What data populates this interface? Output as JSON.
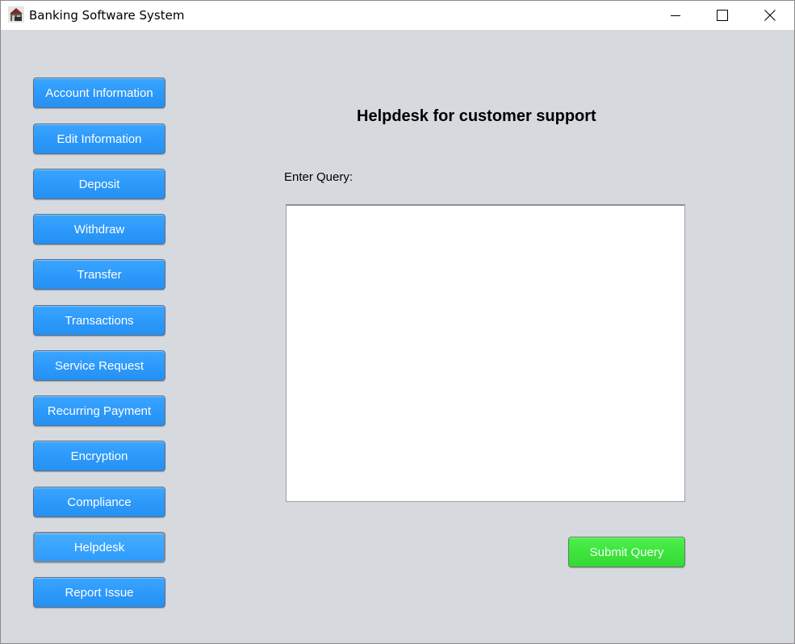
{
  "window": {
    "title": "Banking Software System",
    "icon": "bank-app-icon",
    "controls": {
      "minimize": "minimize-icon",
      "maximize": "maximize-icon",
      "close": "close-icon"
    }
  },
  "sidebar": {
    "items": [
      {
        "label": "Account Information",
        "name": "account-information-button"
      },
      {
        "label": "Edit Information",
        "name": "edit-information-button"
      },
      {
        "label": "Deposit",
        "name": "deposit-button"
      },
      {
        "label": "Withdraw",
        "name": "withdraw-button"
      },
      {
        "label": "Transfer",
        "name": "transfer-button"
      },
      {
        "label": "Transactions",
        "name": "transactions-button"
      },
      {
        "label": "Service Request",
        "name": "service-request-button"
      },
      {
        "label": "Recurring Payment",
        "name": "recurring-payment-button"
      },
      {
        "label": "Encryption",
        "name": "encryption-button"
      },
      {
        "label": "Compliance",
        "name": "compliance-button"
      },
      {
        "label": "Helpdesk",
        "name": "helpdesk-button",
        "active": true
      },
      {
        "label": "Report Issue",
        "name": "report-issue-button"
      }
    ]
  },
  "main": {
    "title": "Helpdesk for customer support",
    "query_label": "Enter Query:",
    "query_value": "",
    "submit_label": "Submit Query"
  },
  "colors": {
    "window_background": "#d6d9de",
    "nav_button": "#2d99fb",
    "submit_button": "#3ee43e",
    "button_text": "#ffffff"
  }
}
